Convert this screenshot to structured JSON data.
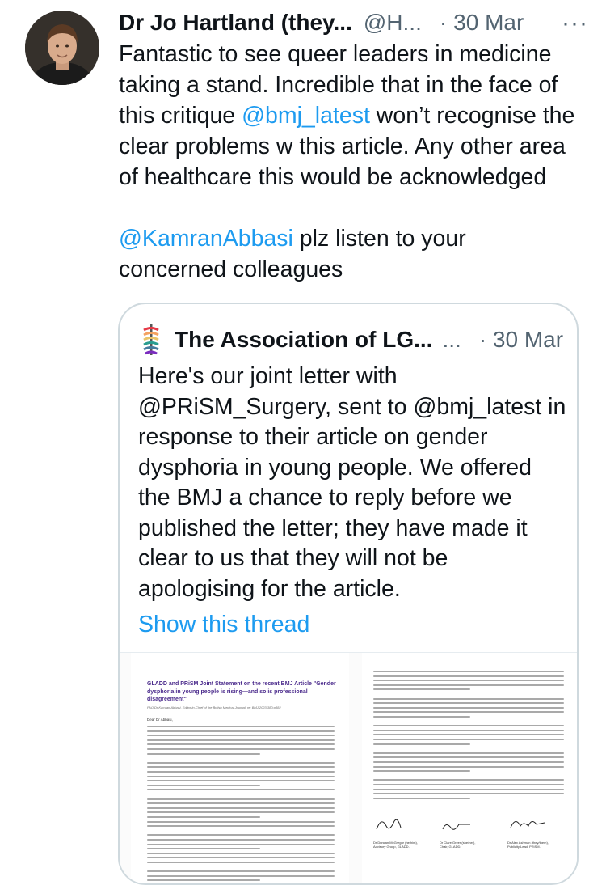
{
  "tweet": {
    "author_name": "Dr Jo Hartland (they...",
    "handle": "@H...",
    "separator": "·",
    "date": "30 Mar",
    "more_label": "···",
    "text_lines": [
      {
        "plain_before": "Fantastic to see queer leaders in medicine",
        "mention": "",
        "plain_after": ""
      },
      {
        "plain_before": "taking a stand. Incredible that in the face of",
        "mention": "",
        "plain_after": ""
      },
      {
        "plain_before": "this critique ",
        "mention": "@bmj_latest",
        "plain_after": " won’t recognise the"
      },
      {
        "plain_before": "clear problems w this article. Any other area",
        "mention": "",
        "plain_after": ""
      },
      {
        "plain_before": "of healthcare this would be acknowledged",
        "mention": "",
        "plain_after": ""
      }
    ],
    "text_lines_2": [
      {
        "plain_before": "",
        "mention": "@KamranAbbasi",
        "plain_after": " plz listen to your"
      },
      {
        "plain_before": "concerned colleagues",
        "mention": "",
        "plain_after": ""
      }
    ]
  },
  "quote": {
    "author_name": "The Association of LG...",
    "name_ellipsis": "...",
    "separator": "·",
    "date": "30 Mar",
    "text": "Here's our joint letter with @PRiSM_Surgery, sent to @bmj_latest in response to their article on gender dysphoria in young people. We offered the BMJ a chance to reply before we published the letter; they have made it clear to us that they will not be apologising for the article.",
    "show_thread": "Show this thread",
    "attachment": {
      "title": "GLADD and PRiSM Joint Statement on the recent BMJ Article \"Gender dysphoria in young people is rising—and so is professional disagreement\"",
      "subtitle": "FAO Dr Kamran Abbasi, Editor-in-Chief of the British Medical Journal, re: BMJ 2023;380:p382",
      "greeting": "Dear Dr Abbasi,",
      "signatories": [
        {
          "name": "Dr Duncan McGregor (he/him),",
          "role": "Advisory Group, GLADD."
        },
        {
          "name": "Dr Clare Greer (she/her),",
          "role": "Chair, GLADD."
        },
        {
          "name": "Dr Alex Ashman (they/them),",
          "role": "Publicity Lead, PRiSM."
        }
      ]
    }
  },
  "icons": {
    "avatar": "avatar-photo",
    "more": "more-horizontal-icon",
    "quote_logo": "rainbow-staff-logo-icon"
  },
  "colors": {
    "link": "#1d9bf0",
    "text": "#0f1419",
    "secondary": "#536471",
    "border": "#cfd9de",
    "doc_title": "#4b2b8c"
  }
}
